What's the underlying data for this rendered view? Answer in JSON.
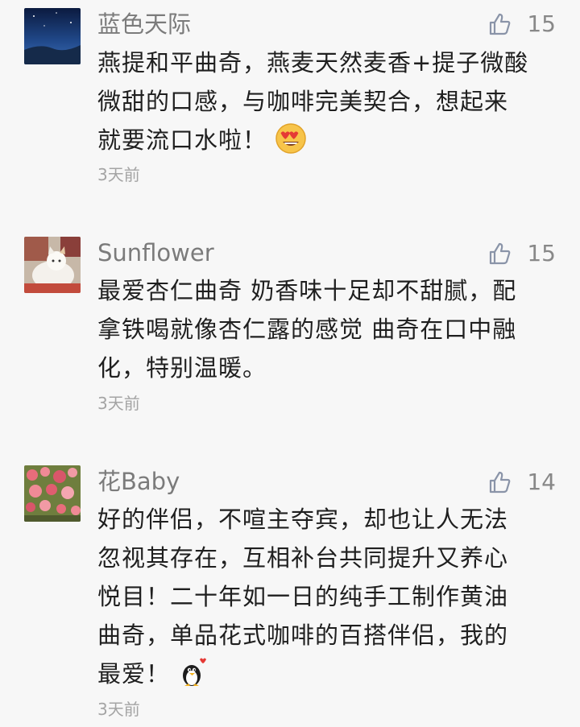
{
  "comments": [
    {
      "name": "蓝色天际",
      "likes": "15",
      "lines": [
        "燕提和平曲奇，燕麦天然麦香+提子微酸",
        "微甜的口感，与咖啡完美契合，想起来",
        "就要流口水啦！"
      ],
      "time": "3天前",
      "emoji": "heart-eyes-emoji"
    },
    {
      "name": "Sunflower",
      "likes": "15",
      "lines": [
        "最爱杏仁曲奇  奶香味十足却不甜腻，配",
        "拿铁喝就像杏仁露的感觉 曲奇在口中融",
        "化，特别温暖。"
      ],
      "time": "3天前"
    },
    {
      "name": "花Baby",
      "likes": "14",
      "lines": [
        "好的伴侣，不喧主夺宾，却也让人无法",
        "忽视其存在，互相补台共同提升又养心",
        "悦目！二十年如一日的纯手工制作黄油",
        "曲奇，单品花式咖啡的百搭伴侣，我的",
        "最爱！"
      ],
      "time": "3天前",
      "emoji": "penguin-heart-emoji"
    }
  ],
  "icons": {
    "like": "thumbs-up-icon"
  },
  "colors": {
    "background": "#f7f7f7",
    "name": "#7b7b7b",
    "time": "#a4a4a4",
    "like_icon": "#8a94a8"
  }
}
